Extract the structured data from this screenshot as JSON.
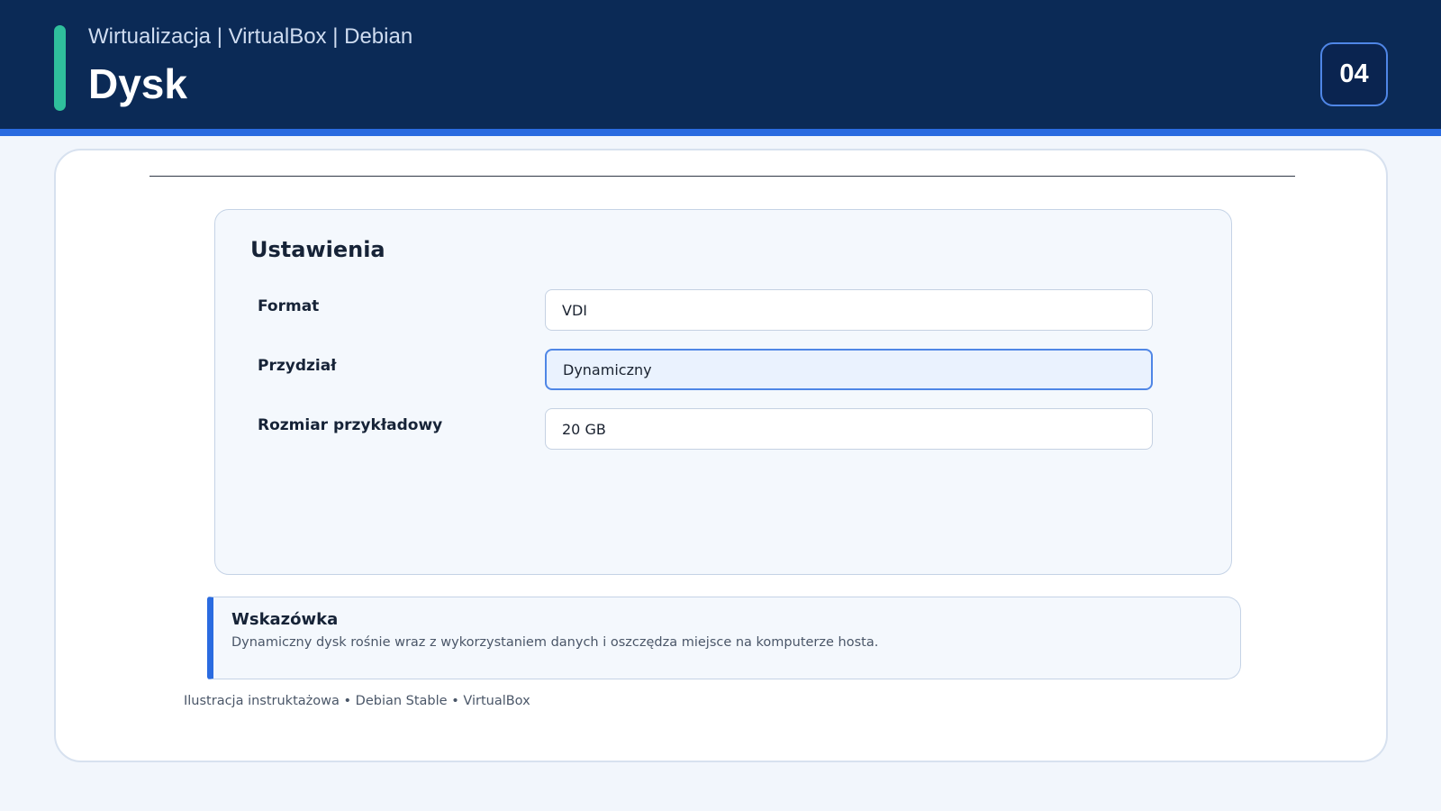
{
  "header": {
    "breadcrumb": "Wirtualizacja | VirtualBox | Debian",
    "title": "Dysk",
    "slide_number": "04"
  },
  "settings": {
    "title": "Ustawienia",
    "fields": [
      {
        "label": "Format",
        "value": "VDI"
      },
      {
        "label": "Przydział",
        "value": "Dynamiczny"
      },
      {
        "label": "Rozmiar przykładowy",
        "value": "20 GB"
      }
    ]
  },
  "tip": {
    "title": "Wskazówka",
    "text": "Dynamiczny dysk rośnie wraz z wykorzystaniem danych i oszczędza miejsce na komputerze hosta."
  },
  "footer": {
    "note": "Ilustracja instruktażowa • Debian Stable • VirtualBox"
  },
  "colors": {
    "header_bg": "#0b2a56",
    "accent_green": "#2fbf9c",
    "accent_blue": "#2a6be0",
    "page_bg": "#f2f6fc"
  }
}
